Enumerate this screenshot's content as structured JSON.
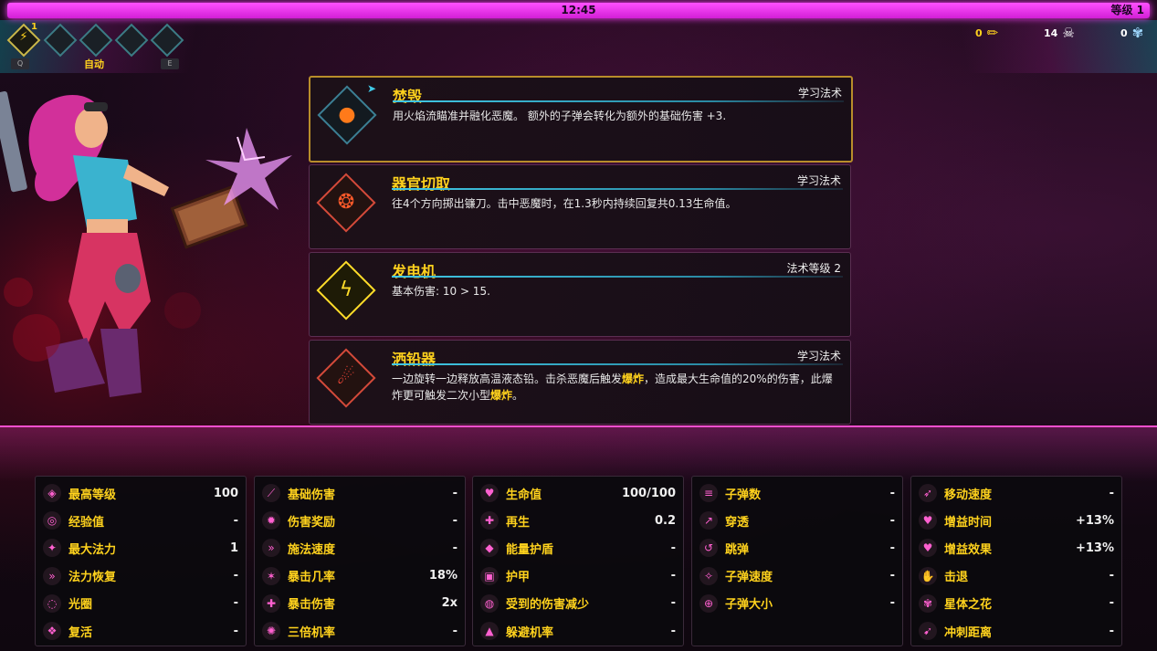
{
  "hud": {
    "timer": "12:45",
    "level": "等级 1",
    "slot_count": "1",
    "auto_label": "自动",
    "key_q": "Q",
    "key_e": "E",
    "resources": [
      {
        "value": "0",
        "icon": "pencil-icon"
      },
      {
        "value": "14",
        "icon": "skull-icon"
      },
      {
        "value": "0",
        "icon": "flower-icon"
      }
    ]
  },
  "cards": [
    {
      "title": "焚毁",
      "tag": "学习法术",
      "desc": "用火焰流瞄准并融化恶魔。 额外的子弹会转化为额外的基础伤害 +3.",
      "icon": "fire-orb-icon",
      "color": "#ff7a1a"
    },
    {
      "title": "器官切取",
      "tag": "学习法术",
      "desc": "往4个方向掷出镰刀。击中恶魔时，在1.3秒内持续回复共0.13生命值。",
      "icon": "scythe-icon",
      "color": "#ff5a2a"
    },
    {
      "title": "发电机",
      "tag": "法术等级 2",
      "desc": "基本伤害: 10 > 15.",
      "icon": "lightning-icon",
      "color": "#ffdd2a"
    },
    {
      "title": "洒铅器",
      "tag": "学习法术",
      "desc_pre": "一边旋转一边释放高温液态铅。击杀恶魔后触发",
      "desc_b1": "爆炸",
      "desc_mid": "，造成最大生命值的20%的伤害，此爆炸更可触发二次小型",
      "desc_b2": "爆炸",
      "desc_post": "。",
      "icon": "molten-lead-icon",
      "color": "#ff4a3a"
    }
  ],
  "stats": [
    [
      {
        "name": "最高等级",
        "value": "100",
        "icon": "max-level-icon"
      },
      {
        "name": "经验值",
        "value": "-",
        "icon": "xp-icon"
      },
      {
        "name": "最大法力",
        "value": "1",
        "icon": "mana-icon"
      },
      {
        "name": "法力恢复",
        "value": "-",
        "icon": "mana-regen-icon"
      },
      {
        "name": "光圈",
        "value": "-",
        "icon": "aura-icon"
      },
      {
        "name": "复活",
        "value": "-",
        "icon": "revive-icon"
      }
    ],
    [
      {
        "name": "基础伤害",
        "value": "-",
        "icon": "damage-icon"
      },
      {
        "name": "伤害奖励",
        "value": "-",
        "icon": "damage-bonus-icon"
      },
      {
        "name": "施法速度",
        "value": "-",
        "icon": "cast-speed-icon"
      },
      {
        "name": "暴击几率",
        "value": "18%",
        "icon": "crit-chance-icon"
      },
      {
        "name": "暴击伤害",
        "value": "2x",
        "icon": "crit-damage-icon"
      },
      {
        "name": "三倍机率",
        "value": "-",
        "icon": "triple-chance-icon"
      }
    ],
    [
      {
        "name": "生命值",
        "value": "100/100",
        "icon": "health-icon"
      },
      {
        "name": "再生",
        "value": "0.2",
        "icon": "regen-icon"
      },
      {
        "name": "能量护盾",
        "value": "-",
        "icon": "shield-icon"
      },
      {
        "name": "护甲",
        "value": "-",
        "icon": "armor-icon"
      },
      {
        "name": "受到的伤害减少",
        "value": "-",
        "icon": "damage-reduction-icon"
      },
      {
        "name": "躲避机率",
        "value": "-",
        "icon": "dodge-icon"
      }
    ],
    [
      {
        "name": "子弹数",
        "value": "-",
        "icon": "projectile-count-icon"
      },
      {
        "name": "穿透",
        "value": "-",
        "icon": "pierce-icon"
      },
      {
        "name": "跳弹",
        "value": "-",
        "icon": "bounce-icon"
      },
      {
        "name": "子弹速度",
        "value": "-",
        "icon": "projectile-speed-icon"
      },
      {
        "name": "子弹大小",
        "value": "-",
        "icon": "projectile-size-icon"
      }
    ],
    [
      {
        "name": "移动速度",
        "value": "-",
        "icon": "move-speed-icon"
      },
      {
        "name": "增益时间",
        "value": "+13%",
        "icon": "buff-duration-icon"
      },
      {
        "name": "增益效果",
        "value": "+13%",
        "icon": "buff-effect-icon"
      },
      {
        "name": "击退",
        "value": "-",
        "icon": "knockback-icon"
      },
      {
        "name": "星体之花",
        "value": "-",
        "icon": "astral-flower-icon"
      },
      {
        "name": "冲刺距离",
        "value": "-",
        "icon": "dash-distance-icon"
      }
    ]
  ]
}
